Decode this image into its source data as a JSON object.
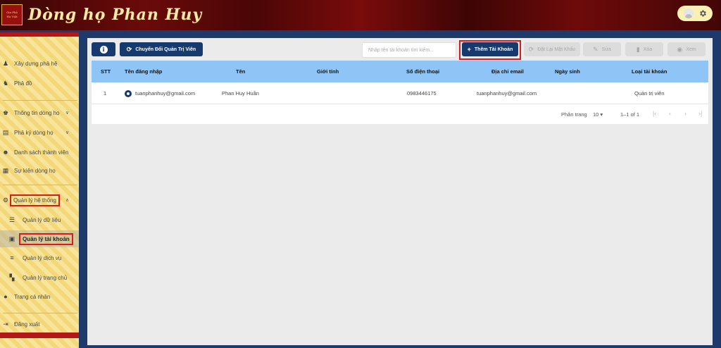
{
  "header": {
    "logo_line1": "Gia Phả",
    "logo_line2": "Họ Việt",
    "brand": "Dòng họ Phan Huy"
  },
  "sidebar": {
    "items": [
      {
        "label": "Xây dựng phả hệ",
        "icon": "tree-icon"
      },
      {
        "label": "Phả đồ",
        "icon": "family-chart-icon"
      },
      {
        "label": "Thông tin dòng họ",
        "icon": "family-icon"
      },
      {
        "label": "Phả ký dòng họ",
        "icon": "book-icon"
      },
      {
        "label": "Danh sách thành viên",
        "icon": "members-icon"
      },
      {
        "label": "Sự kiện dòng họ",
        "icon": "calendar-icon"
      },
      {
        "label": "Quản lý hệ thống",
        "icon": "gear-icon"
      },
      {
        "label": "Quản lý dữ liệu",
        "icon": "storage-icon"
      },
      {
        "label": "Quản lý tài khoản",
        "icon": "account-box-icon"
      },
      {
        "label": "Quản lý dịch vụ",
        "icon": "list-icon"
      },
      {
        "label": "Quản lý trang chủ",
        "icon": "dashboard-icon"
      },
      {
        "label": "Trang cá nhân",
        "icon": "person-icon"
      },
      {
        "label": "Đăng xuất",
        "icon": "logout-icon"
      }
    ]
  },
  "toolbar": {
    "switch_label": "Chuyển Đổi Quản Trị Viên",
    "search_placeholder": "Nhập tên tài khoản tìm kiếm...",
    "add_label": "Thêm Tài Khoản",
    "reset_label": "Đặt Lại Mật Khẩu",
    "edit_label": "Sửa",
    "delete_label": "Xóa",
    "view_label": "Xem"
  },
  "table": {
    "columns": [
      "STT",
      "Tên đăng nhập",
      "Tên",
      "Giới tính",
      "Số điện thoại",
      "Địa chỉ email",
      "Ngày sinh",
      "Loại tài khoản"
    ],
    "rows": [
      {
        "stt": "1",
        "username": "tuanphanhuy@gmail.com",
        "name": "Phan Huy Huân",
        "gender": "",
        "phone": "0983446175",
        "email": "tuanphanhuy@gmail.com",
        "dob": "",
        "type": "Quản trị viên"
      }
    ]
  },
  "pager": {
    "per_page_label": "Phân trang",
    "per_page_value": "10",
    "range": "1–1 of 1"
  },
  "colors": {
    "primary": "#173a6e",
    "header_row": "#8ec5f6",
    "highlight": "#d81b1b"
  }
}
